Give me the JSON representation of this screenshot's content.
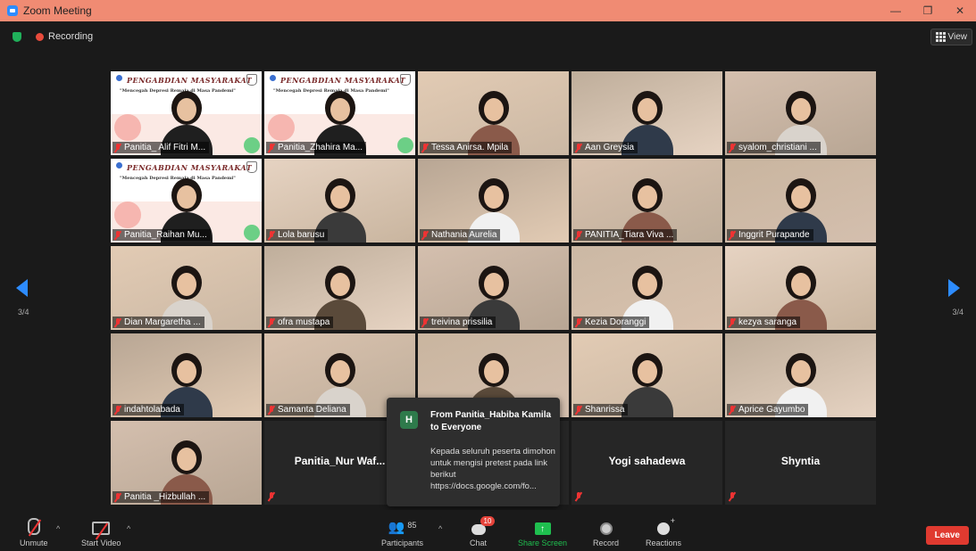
{
  "window": {
    "title": "Zoom Meeting",
    "minimize": "—",
    "restore": "❐",
    "close": "✕"
  },
  "topbar": {
    "recording_label": "Recording",
    "view_label": "View"
  },
  "banner": {
    "title": "PENGABDIAN MASYARAKAT",
    "subtitle": "\"Mencegah Depresi Remaja di Masa Pandemi\""
  },
  "gallery": {
    "tiles": [
      {
        "name": "Panitia_ Alif Fitri M...",
        "kind": "banner"
      },
      {
        "name": "Panitia_Zhahira Ma...",
        "kind": "banner"
      },
      {
        "name": "Tessa Anirsa. Mpila",
        "kind": "video"
      },
      {
        "name": "Aan Greysia",
        "kind": "video"
      },
      {
        "name": "syalom_christiani ...",
        "kind": "video"
      },
      {
        "name": "Panitia_Raihan Mu...",
        "kind": "banner"
      },
      {
        "name": "Lola barusu",
        "kind": "video"
      },
      {
        "name": "Nathania Aurelia",
        "kind": "video"
      },
      {
        "name": "PANITIA_Tiara Viva ...",
        "kind": "video"
      },
      {
        "name": "Inggrit Purapande",
        "kind": "video"
      },
      {
        "name": "Dian Margaretha ...",
        "kind": "video"
      },
      {
        "name": "ofra mustapa",
        "kind": "video"
      },
      {
        "name": "treivina prissilia",
        "kind": "video"
      },
      {
        "name": "Kezia Doranggi",
        "kind": "video"
      },
      {
        "name": "kezya saranga",
        "kind": "video"
      },
      {
        "name": "indahtolabada",
        "kind": "video"
      },
      {
        "name": "Samanta Deliana",
        "kind": "video"
      },
      {
        "name": "",
        "kind": "video"
      },
      {
        "name": "Shanrissa",
        "kind": "video"
      },
      {
        "name": "Aprice Gayumbo",
        "kind": "video"
      },
      {
        "name": "Panitia _Hizbullah ...",
        "kind": "video"
      },
      {
        "name": "Panitia_Nur  Waf...",
        "kind": "name-only"
      },
      {
        "name": "",
        "kind": "empty"
      },
      {
        "name": "Yogi sahadewa",
        "kind": "name-only"
      },
      {
        "name": "Shyntia",
        "kind": "name-only"
      }
    ]
  },
  "pagination": {
    "left": "3/4",
    "right": "3/4"
  },
  "chat_popup": {
    "avatar_letter": "H",
    "from": "From Panitia_Habiba Kamila to Everyone",
    "message": "Kepada seluruh peserta dimohon untuk mengisi pretest pada link berikut https://docs.google.com/fo..."
  },
  "toolbar": {
    "unmute": "Unmute",
    "start_video": "Start Video",
    "participants": "Participants",
    "participants_count": "85",
    "chat": "Chat",
    "chat_badge": "10",
    "share_screen": "Share Screen",
    "record": "Record",
    "reactions": "Reactions",
    "leave": "Leave",
    "caret": "^"
  },
  "colors": {
    "accent": "#2d8cff",
    "share": "#1fbf4f",
    "leave": "#e03a30",
    "titlebar": "#f08b73"
  }
}
